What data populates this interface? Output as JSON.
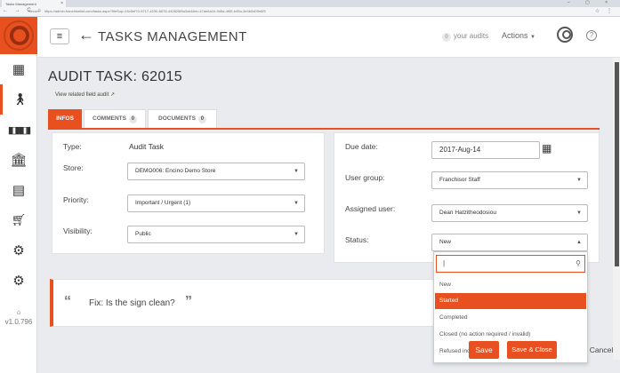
{
  "browser": {
    "tab_title": "Tasks Management",
    "secure_label": "Secure",
    "url": "https://admin.franchiselist.com/tasks.aspx?fileSup=16c5ef70-5717-4230-8678-440825f8a3cb&bis=47ae6a1b-9d5a-4f65-b45a-3e4b0d09e6f3"
  },
  "sidebar": {
    "version": "v1.0.796",
    "items": [
      {
        "icon": "grid-icon",
        "glyph": "▦"
      },
      {
        "icon": "person-icon",
        "glyph": "🚶"
      },
      {
        "icon": "barcode-icon",
        "glyph": "▮▮▮"
      },
      {
        "icon": "bank-icon",
        "glyph": "🏛"
      },
      {
        "icon": "calculator-icon",
        "glyph": "▤"
      },
      {
        "icon": "cart-icon",
        "glyph": "🛒"
      },
      {
        "icon": "cogs-icon",
        "glyph": "⚙"
      },
      {
        "icon": "gear-icon",
        "glyph": "⚙"
      }
    ]
  },
  "header": {
    "title": "TASKS MANAGEMENT",
    "audits_count": "0",
    "audits_label": "your audits",
    "actions_label": "Actions"
  },
  "task": {
    "title": "AUDIT TASK: 62015",
    "view_related_label": "View related field audit"
  },
  "tabs": [
    {
      "label": "INFOS",
      "count": ""
    },
    {
      "label": "COMMENTS",
      "count": "0"
    },
    {
      "label": "DOCUMENTS",
      "count": "0"
    }
  ],
  "form_left": {
    "type_label": "Type:",
    "type_value": "Audit Task",
    "store_label": "Store:",
    "store_value": "DEMO006: Encino Demo Store",
    "priority_label": "Priority:",
    "priority_value": "Important / Urgent (1)",
    "visibility_label": "Visibility:",
    "visibility_value": "Public"
  },
  "form_right": {
    "due_label": "Due date:",
    "due_value": "2017-Aug-14",
    "group_label": "User group:",
    "group_value": "Franchisor Staff",
    "assigned_label": "Assigned user:",
    "assigned_value": "Dean Hatzitheodosiou",
    "status_label": "Status:",
    "status_value": "New"
  },
  "status_dropdown": {
    "search_value": "|",
    "options": [
      {
        "label": "New",
        "selected": false
      },
      {
        "label": "Started",
        "selected": true
      },
      {
        "label": "Completed",
        "selected": false
      },
      {
        "label": "Closed (no action required / invalid)",
        "selected": false
      },
      {
        "label": "Refused incomplete",
        "selected": false
      }
    ]
  },
  "fix": {
    "text": "Fix: Is the sign clean?"
  },
  "buttons": {
    "save": "Save",
    "save_close": "Save & Close",
    "cancel": "Cancel"
  },
  "colors": {
    "accent": "#e8511f"
  }
}
